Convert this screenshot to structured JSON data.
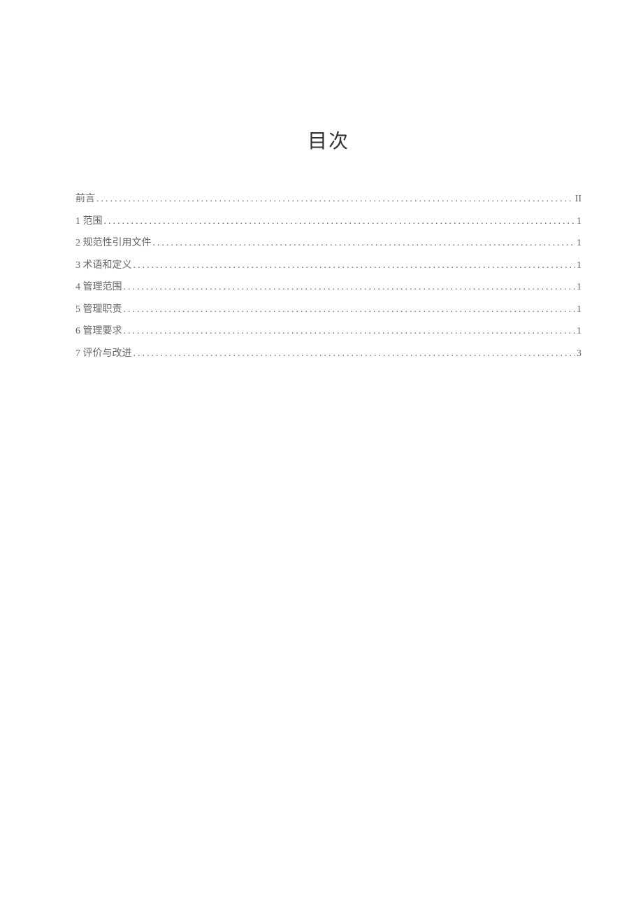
{
  "title": "目次",
  "toc": [
    {
      "label": "前言",
      "page": "II"
    },
    {
      "label": "1 范围",
      "page": "1"
    },
    {
      "label": "2 规范性引用文件",
      "page": "1"
    },
    {
      "label": "3 术语和定义",
      "page": "1"
    },
    {
      "label": "4 管理范围",
      "page": "1"
    },
    {
      "label": "5 管理职责",
      "page": "1"
    },
    {
      "label": "6 管理要求",
      "page": "1"
    },
    {
      "label": "7 评价与改进",
      "page": "3"
    }
  ]
}
